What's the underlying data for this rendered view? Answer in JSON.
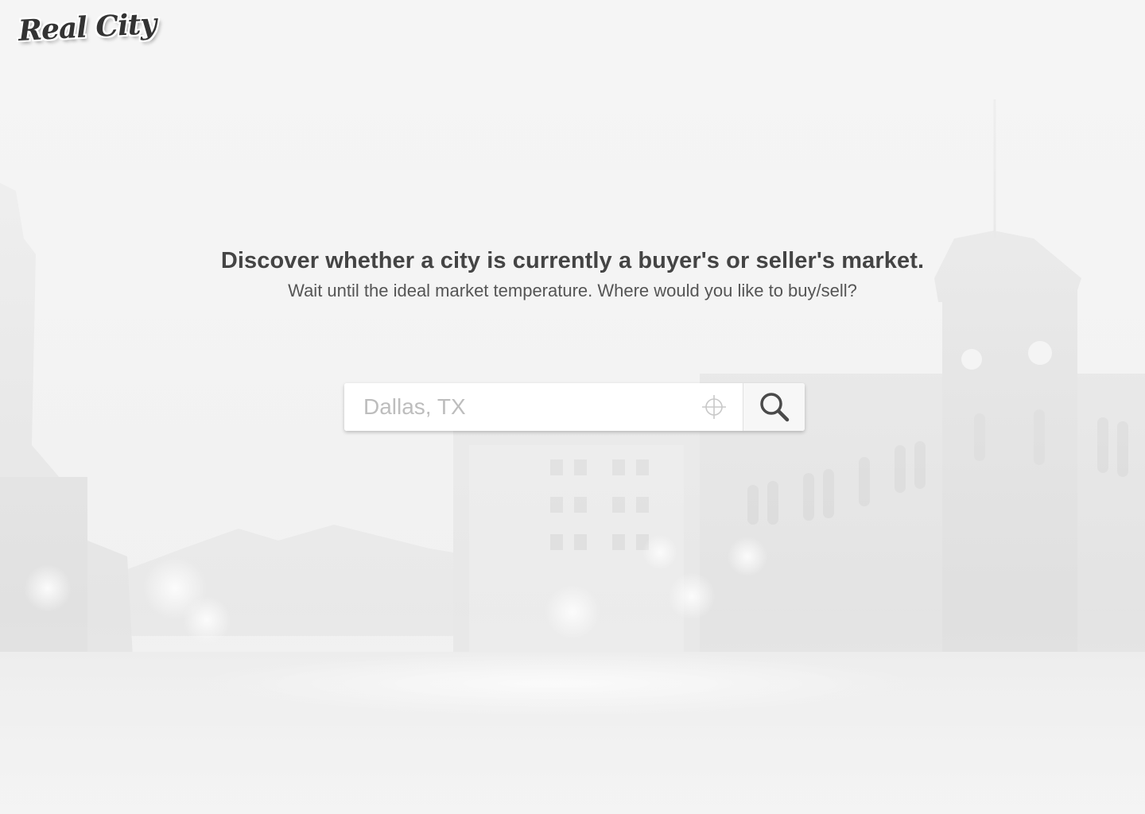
{
  "brand": {
    "logo_text": "Real City"
  },
  "hero": {
    "headline": "Discover whether a city is currently a buyer's or seller's market.",
    "subline": "Wait until the ideal market temperature. Where would you like to buy/sell?"
  },
  "search": {
    "placeholder": "Dallas, TX",
    "value": "",
    "locate_icon": "crosshair-icon",
    "submit_icon": "search-icon"
  },
  "colors": {
    "background": "#f3f3f3",
    "headline": "#444444",
    "subline": "#555555",
    "placeholder": "#bdbdbd"
  }
}
